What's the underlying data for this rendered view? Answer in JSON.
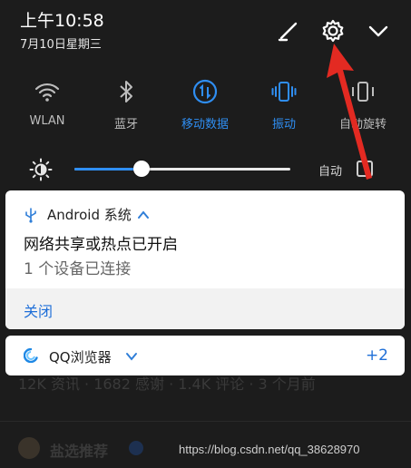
{
  "status": {
    "time": "上午10:58",
    "date": "7月10日星期三"
  },
  "header_icons": [
    "edit-icon",
    "settings-gear-icon",
    "expand-chevron-icon"
  ],
  "toggles": [
    {
      "label": "WLAN",
      "icon": "wifi-icon",
      "active": false
    },
    {
      "label": "蓝牙",
      "icon": "bluetooth-icon",
      "active": false
    },
    {
      "label": "移动数据",
      "icon": "mobile-data-icon",
      "active": true
    },
    {
      "label": "振动",
      "icon": "vibrate-icon",
      "active": true
    },
    {
      "label": "自动旋转",
      "icon": "auto-rotate-icon",
      "active": false
    }
  ],
  "brightness": {
    "level": 0.31,
    "auto_label": "自动",
    "auto_checked": false
  },
  "notification_android": {
    "app_name": "Android 系统",
    "title": "网络共享或热点已开启",
    "text": "1 个设备已连接",
    "action": "关闭"
  },
  "notification_qq": {
    "app_name": "QQ浏览器",
    "count": "+2"
  },
  "background": {
    "stats": "12K 资讯 · 1682 感谢 · 1.4K 评论 · 3 个月前",
    "title": "盐选推荐"
  },
  "watermark": "https://blog.csdn.net/qq_38628970",
  "colors": {
    "accent": "#2f8ef2",
    "arrow": "#e32a22",
    "shade": "#1c1c1c"
  }
}
